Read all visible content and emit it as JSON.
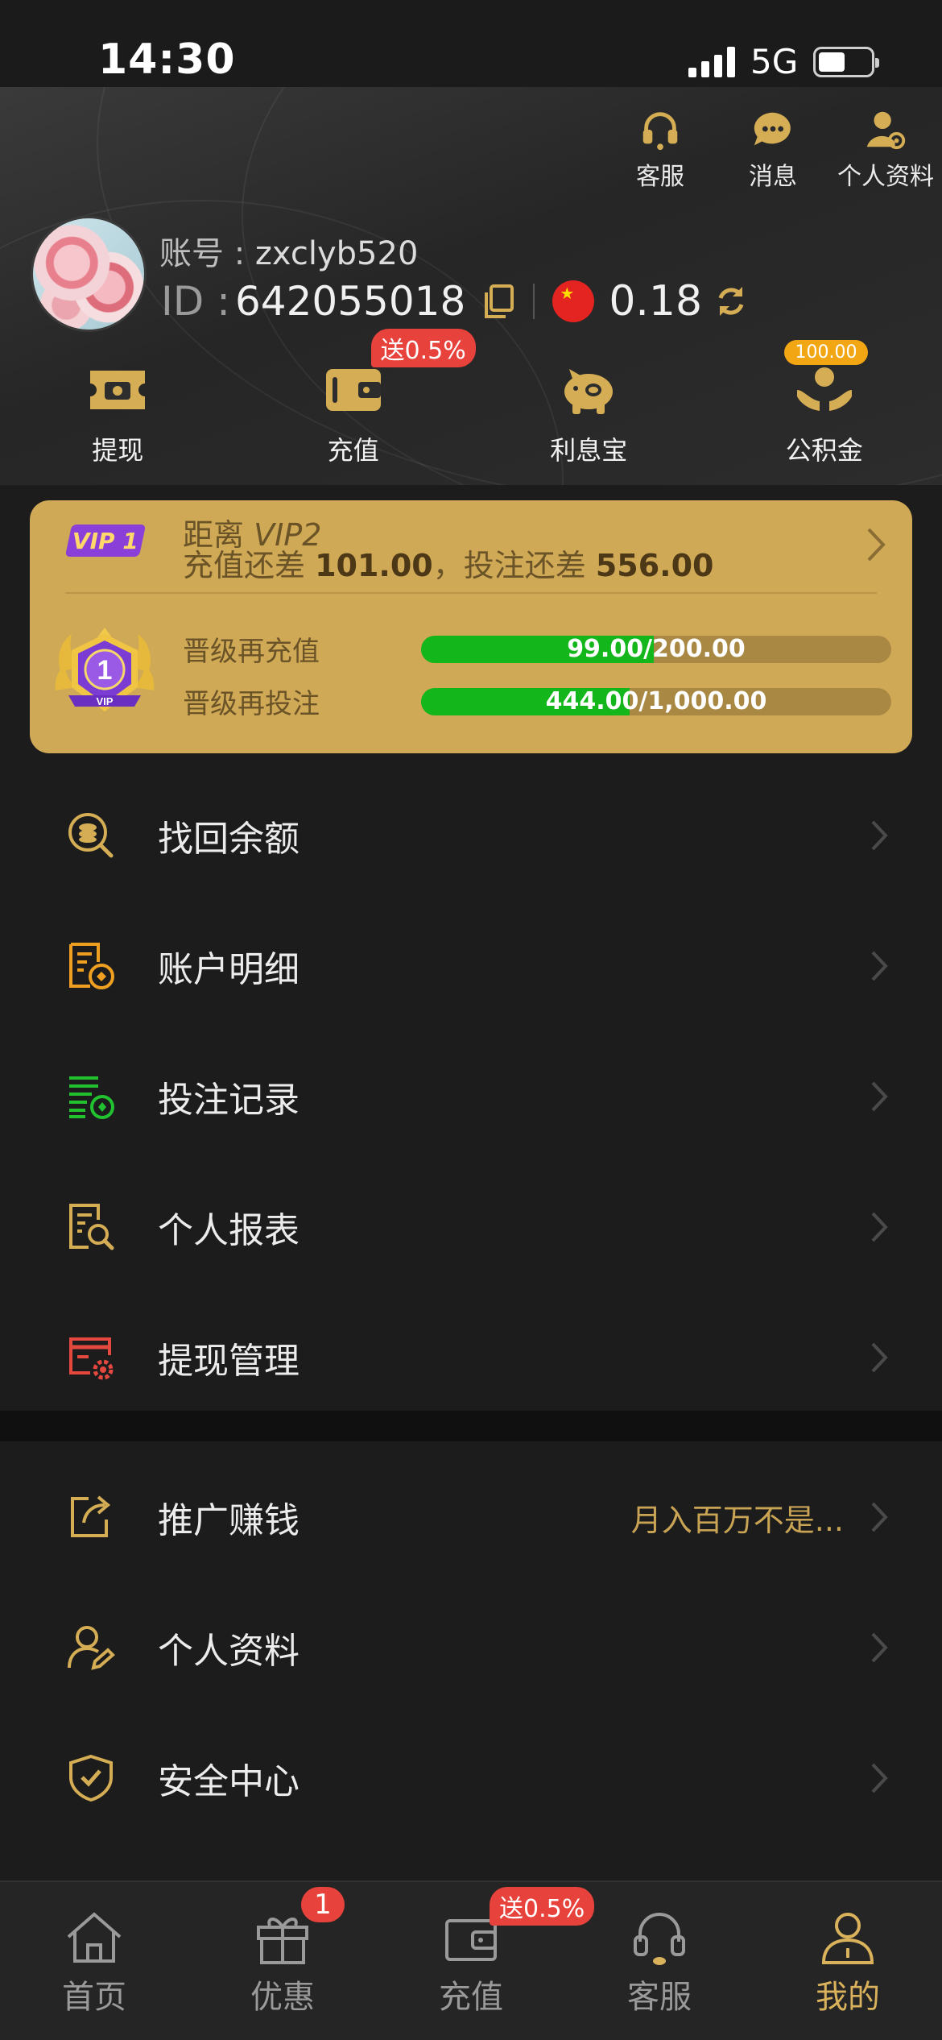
{
  "status_bar": {
    "time": "14:30",
    "network": "5G"
  },
  "header": {
    "top_actions": [
      {
        "label": "客服",
        "icon": "headset-icon"
      },
      {
        "label": "消息",
        "icon": "chat-bubble-icon"
      },
      {
        "label": "个人资料",
        "icon": "user-settings-icon"
      }
    ],
    "account_label": "账号 : ",
    "account_value": "zxclyb520",
    "id_label": "ID :",
    "id_value": "642055018",
    "balance": "0.18",
    "currency_icon": "china-flag-icon"
  },
  "quick_actions": [
    {
      "label": "提现",
      "icon": "ticket-icon",
      "tag": ""
    },
    {
      "label": "充值",
      "icon": "wallet-icon",
      "tag": "送0.5%"
    },
    {
      "label": "利息宝",
      "icon": "piggy-bank-icon",
      "tag": ""
    },
    {
      "label": "公积金",
      "icon": "hands-coin-icon",
      "tag": "100.00"
    }
  ],
  "vip": {
    "level_badge": "VIP 1",
    "next_prefix": "距离 ",
    "next_level": "VIP2",
    "diff_deposit_label": "充值还差 ",
    "diff_deposit_value": "101.00",
    "diff_sep": "，",
    "diff_bet_label": "投注还差 ",
    "diff_bet_value": "556.00",
    "medal_number": "1",
    "medal_text": "VIP",
    "progress": [
      {
        "label": "晋级再充值",
        "text": "99.00/200.00",
        "fraction": 0.495
      },
      {
        "label": "晋级再投注",
        "text": "444.00/1,000.00",
        "fraction": 0.444
      }
    ]
  },
  "menu_group1": [
    {
      "label": "找回余额",
      "icon": "coin-search-icon",
      "color": "#d4ad55"
    },
    {
      "label": "账户明细",
      "icon": "document-coin-icon",
      "color": "#f0a020"
    },
    {
      "label": "投注记录",
      "icon": "list-record-icon",
      "color": "#21c130"
    },
    {
      "label": "个人报表",
      "icon": "report-search-icon",
      "color": "#d4ad55"
    },
    {
      "label": "提现管理",
      "icon": "card-gear-icon",
      "color": "#e5483f"
    }
  ],
  "menu_group2": [
    {
      "label": "推广赚钱",
      "icon": "share-icon",
      "extra": "月入百万不是..."
    },
    {
      "label": "个人资料",
      "icon": "user-edit-icon",
      "extra": ""
    },
    {
      "label": "安全中心",
      "icon": "shield-check-icon",
      "extra": ""
    }
  ],
  "tabbar": [
    {
      "label": "首页",
      "icon": "home-icon",
      "badge": "",
      "active": false
    },
    {
      "label": "优惠",
      "icon": "gift-icon",
      "badge": "1",
      "active": false
    },
    {
      "label": "充值",
      "icon": "wallet-icon",
      "badge": "送0.5%",
      "active": false
    },
    {
      "label": "客服",
      "icon": "headset-icon",
      "badge": "",
      "active": false
    },
    {
      "label": "我的",
      "icon": "user-icon",
      "badge": "",
      "active": true
    }
  ],
  "colors": {
    "gold": "#d4ad55",
    "vip_card": "#cfa955",
    "progress": "#13b71c",
    "badge_red": "#e8423c",
    "background": "#1c1c1d"
  }
}
